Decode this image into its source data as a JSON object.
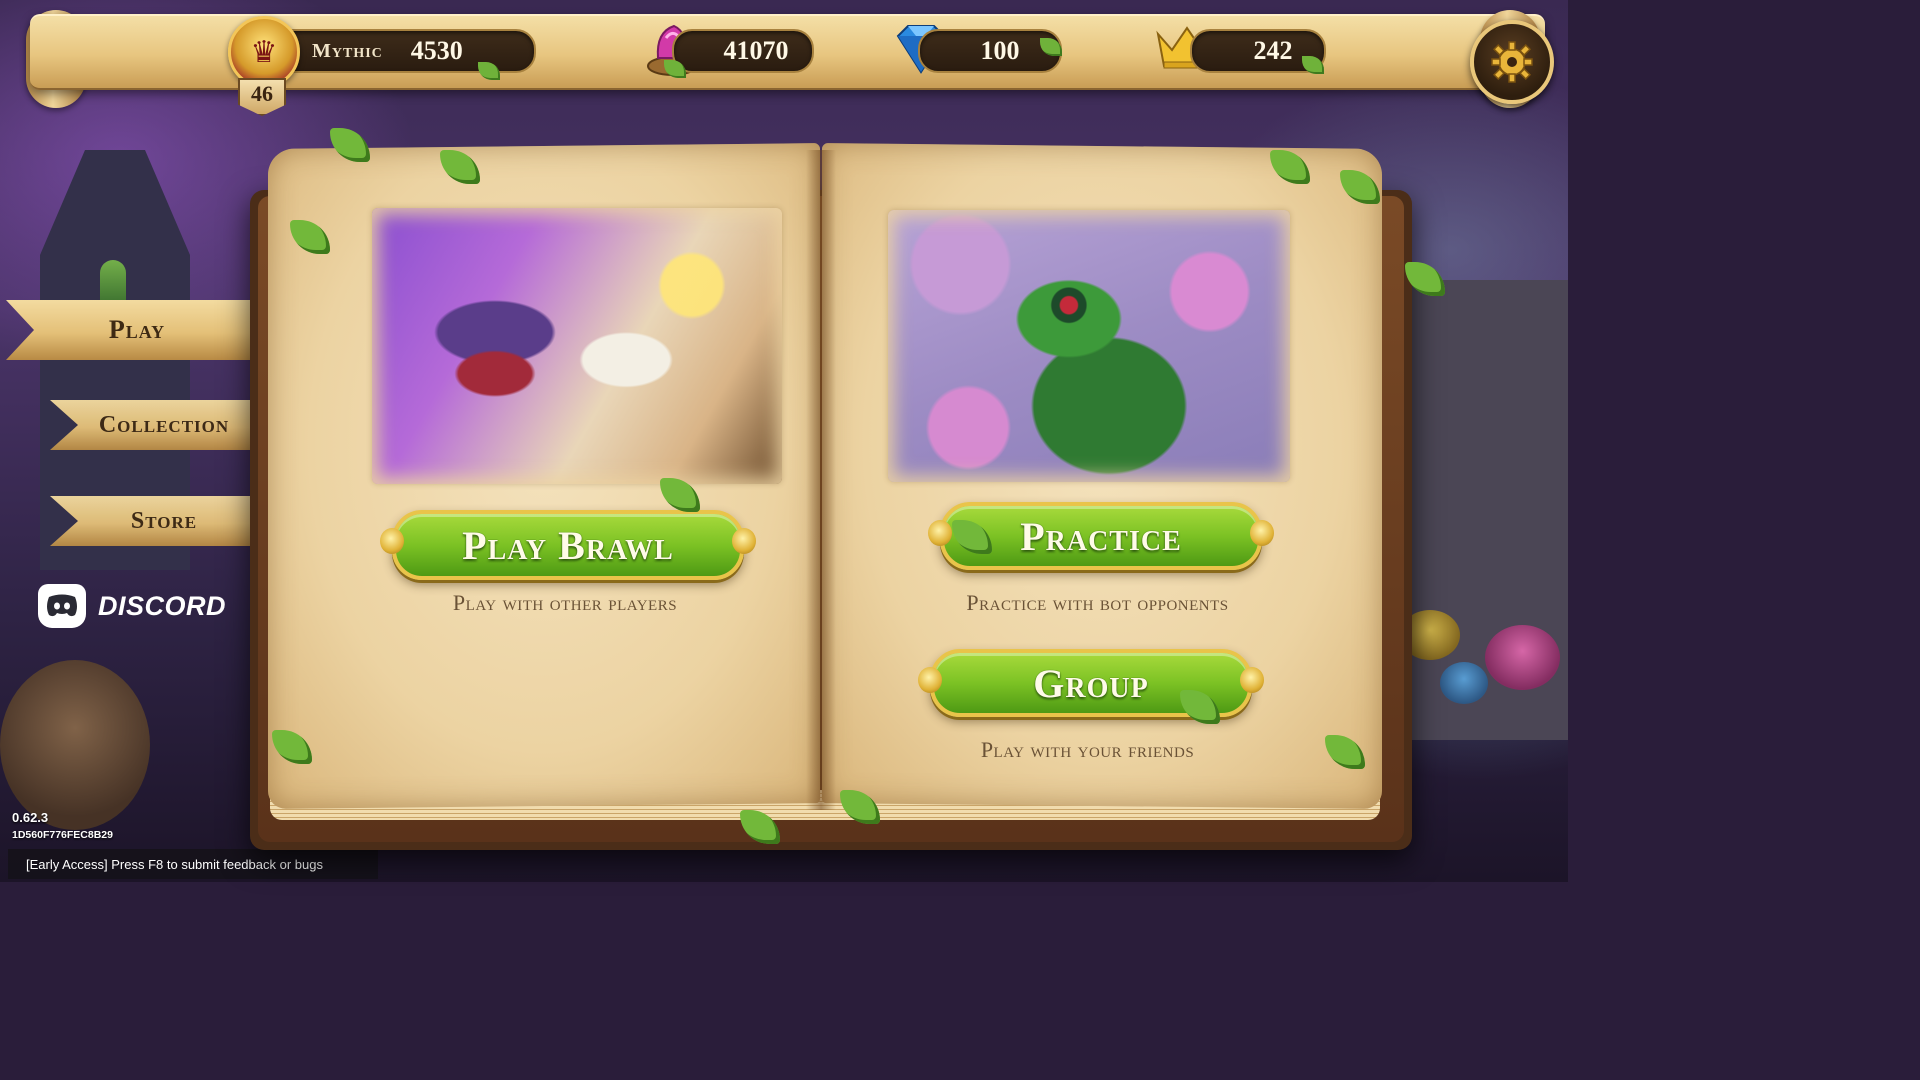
{
  "header": {
    "rank": {
      "label": "Mythic",
      "value": "4530",
      "level": "46"
    },
    "gems": {
      "value": "41070"
    },
    "diamonds": {
      "value": "100"
    },
    "crowns": {
      "value": "242"
    }
  },
  "nav": {
    "items": [
      {
        "label": "Play"
      },
      {
        "label": "Collection"
      },
      {
        "label": "Store"
      }
    ],
    "discord": "DISCORD"
  },
  "book": {
    "left": {
      "button": "Play Brawl",
      "subtitle": "Play with other players"
    },
    "right_top": {
      "button": "Practice",
      "subtitle": "Practice with bot opponents"
    },
    "right_bottom": {
      "button": "Group",
      "subtitle": "Play with your friends"
    }
  },
  "footer": {
    "version": "0.62.3",
    "build": "1D560F776FEC8B29",
    "early_access": "[Early Access] Press F8 to submit feedback or bugs"
  },
  "colors": {
    "button_green": "#7cc224",
    "gold_border": "#e9c44a",
    "parchment": "#ecd3a2",
    "pill_dark": "#2a1c10"
  }
}
